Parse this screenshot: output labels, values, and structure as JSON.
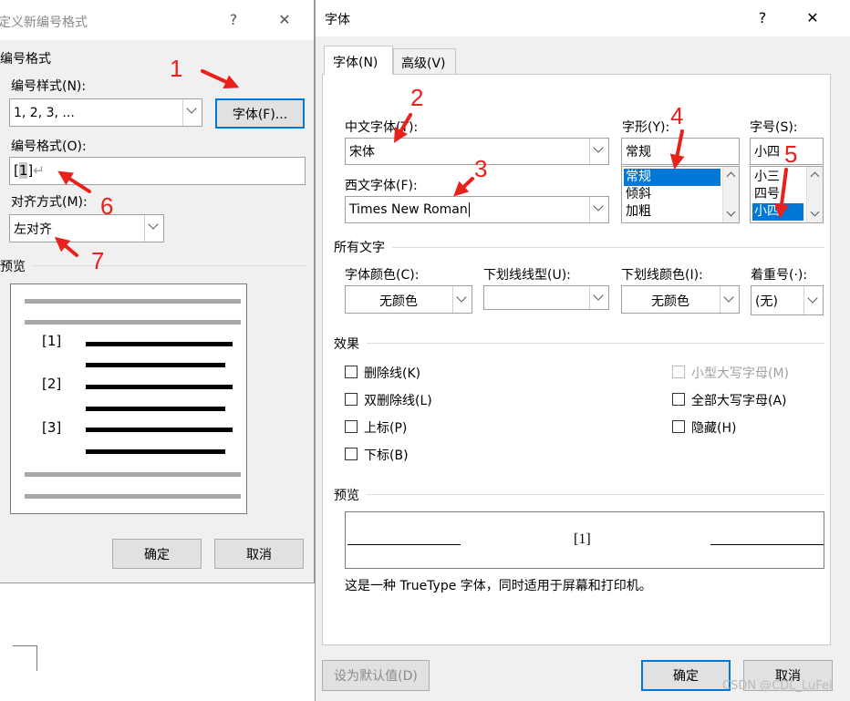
{
  "left_dialog": {
    "title": "定义新编号格式",
    "help": "?",
    "close": "✕",
    "group_title": "编号格式",
    "style_label": "编号样式(N):",
    "style_value": "1, 2, 3, ...",
    "font_button": "字体(F)...",
    "format_label": "编号格式(O):",
    "format_prefix": "[",
    "format_highlight": "1",
    "format_suffix": "]",
    "format_mark": "↵",
    "align_label": "对齐方式(M):",
    "align_value": "左对齐",
    "preview_title": "预览",
    "preview_items": [
      "[1]",
      "[2]",
      "[3]"
    ],
    "ok": "确定",
    "cancel": "取消"
  },
  "font_dialog": {
    "title": "字体",
    "help": "?",
    "close": "✕",
    "tabs": [
      "字体(N)",
      "高级(V)"
    ],
    "chinese_font_label": "中文字体(T):",
    "chinese_font_value": "宋体",
    "western_font_label": "西文字体(F):",
    "western_font_value": "Times New Roman",
    "style_label": "字形(Y):",
    "style_value": "常规",
    "style_options": [
      "常规",
      "倾斜",
      "加粗"
    ],
    "size_label": "字号(S):",
    "size_value": "小四",
    "size_options": [
      "小三",
      "四号",
      "小四"
    ],
    "all_text_title": "所有文字",
    "font_color_label": "字体颜色(C):",
    "font_color_value": "无颜色",
    "underline_style_label": "下划线线型(U):",
    "underline_style_value": "",
    "underline_color_label": "下划线颜色(I):",
    "underline_color_value": "无颜色",
    "emphasis_label": "着重号(·):",
    "emphasis_value": "(无)",
    "effects_title": "效果",
    "effects_left": [
      "删除线(K)",
      "双删除线(L)",
      "上标(P)",
      "下标(B)"
    ],
    "effects_right": [
      "小型大写字母(M)",
      "全部大写字母(A)",
      "隐藏(H)"
    ],
    "preview_title": "预览",
    "preview_text": "[1]",
    "info_text": "这是一种 TrueType 字体，同时适用于屏幕和打印机。",
    "set_default": "设为默认值(D)",
    "ok": "确定",
    "cancel": "取消"
  },
  "annotations": [
    "1",
    "2",
    "3",
    "4",
    "5",
    "6",
    "7"
  ],
  "watermark": "CSDN @CDL_LuFei",
  "colors": {
    "selection": "#0078d7",
    "annotation": "#e8211b"
  }
}
